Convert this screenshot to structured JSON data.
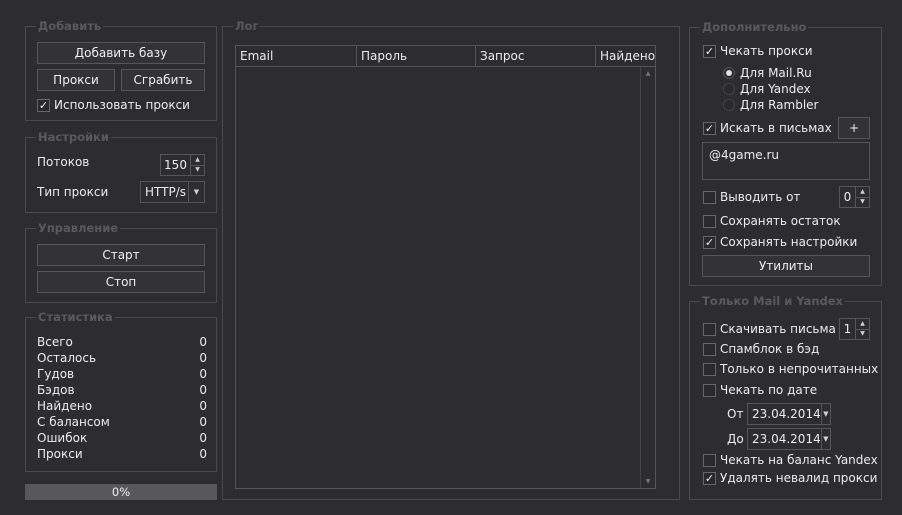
{
  "add_group": {
    "title": "Добавить",
    "add_base_label": "Добавить базу",
    "proxy_label": "Прокси",
    "grab_label": "Сграбить",
    "use_proxy_label": "Использовать прокси",
    "use_proxy_checked": true
  },
  "settings_group": {
    "title": "Настройки",
    "threads_label": "Потоков",
    "threads_value": "150",
    "proxy_type_label": "Тип прокси",
    "proxy_type_value": "HTTP/s"
  },
  "control_group": {
    "title": "Управление",
    "start_label": "Старт",
    "stop_label": "Стоп"
  },
  "stats_group": {
    "title": "Статистика",
    "rows": [
      {
        "label": "Всего",
        "value": "0"
      },
      {
        "label": "Осталось",
        "value": "0"
      },
      {
        "label": "Гудов",
        "value": "0"
      },
      {
        "label": "Бэдов",
        "value": "0"
      },
      {
        "label": "Найдено",
        "value": "0"
      },
      {
        "label": "С балансом",
        "value": "0"
      },
      {
        "label": "Ошибок",
        "value": "0"
      },
      {
        "label": "Прокси",
        "value": "0"
      }
    ]
  },
  "progress": {
    "text": "0%",
    "fraction": 0
  },
  "log_group": {
    "title": "Лог",
    "columns": [
      "Email",
      "Пароль",
      "Запрос",
      "Найдено"
    ]
  },
  "extra_group": {
    "title": "Дополнительно",
    "check_proxy_label": "Чекать прокси",
    "check_proxy_checked": true,
    "radios": [
      {
        "label": "Для Mail.Ru",
        "selected": true
      },
      {
        "label": "Для Yandex",
        "selected": false
      },
      {
        "label": "Для Rambler",
        "selected": false
      }
    ],
    "search_in_mail_label": "Искать в письмах",
    "search_in_mail_checked": true,
    "add_plus_label": "+",
    "search_text": "@4game.ru",
    "output_from_label": "Выводить от",
    "output_from_checked": false,
    "output_from_value": "0",
    "save_rest_label": "Сохранять остаток",
    "save_rest_checked": false,
    "save_settings_label": "Сохранять настройки",
    "save_settings_checked": true,
    "utilities_label": "Утилиты"
  },
  "mail_yandex_group": {
    "title": "Только Mail и Yandex",
    "download_label": "Скачивать письма",
    "download_checked": false,
    "download_value": "1",
    "spam_label": "Спамблок в бэд",
    "spam_checked": false,
    "unread_label": "Только в непрочитанных",
    "unread_checked": false,
    "by_date_label": "Чекать по дате",
    "by_date_checked": false,
    "from_label": "От",
    "from_date": "23.04.2014",
    "to_label": "До",
    "to_date": "23.04.2014",
    "yandex_balance_label": "Чекать на баланс Yandex",
    "yandex_balance_checked": false,
    "remove_invalid_label": "Удалять невалид прокси",
    "remove_invalid_checked": true
  },
  "glyphs": {
    "check": "✓",
    "up": "▲",
    "down": "▼"
  }
}
